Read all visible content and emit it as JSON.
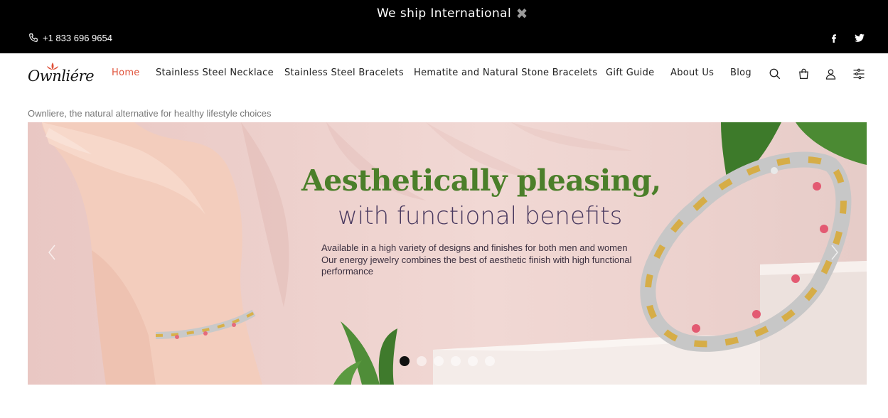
{
  "announcement": {
    "text": "We ship International",
    "close_icon": "close-icon"
  },
  "contact": {
    "phone": "+1 833 696 9654",
    "phone_icon": "phone-icon"
  },
  "social": [
    {
      "name": "facebook-icon"
    },
    {
      "name": "twitter-icon"
    }
  ],
  "logo": {
    "text": "Ownliére",
    "mark": "lotus-icon"
  },
  "nav": {
    "items": [
      {
        "label": "Home",
        "active": true
      },
      {
        "label": "Stainless Steel Necklace",
        "active": false
      },
      {
        "label": "Stainless Steel Bracelets",
        "active": false
      },
      {
        "label": "Hematite and Natural Stone Bracelets",
        "active": false
      },
      {
        "label": "Gift Guide",
        "active": false
      },
      {
        "label": "About Us",
        "active": false
      },
      {
        "label": "Blog",
        "active": false
      }
    ],
    "icons": [
      "search-icon",
      "bag-icon",
      "account-icon",
      "settings-sliders-icon"
    ]
  },
  "tagline": "Ownliere, the natural alternative for healthy lifestyle choices",
  "hero": {
    "headline": "Aesthetically pleasing,",
    "subheadline": "with functional benefits",
    "description": [
      "Available in a high variety of designs and finishes for both men and women",
      "Our energy jewelry combines the best of aesthetic finish with high functional",
      "performance"
    ],
    "slides_total": 6,
    "active_slide": 1
  },
  "colors": {
    "accent": "#e0523a",
    "headline_green": "#4b7f2a",
    "subheadline_purple": "#4a3a60",
    "topbar_bg": "#000000"
  }
}
